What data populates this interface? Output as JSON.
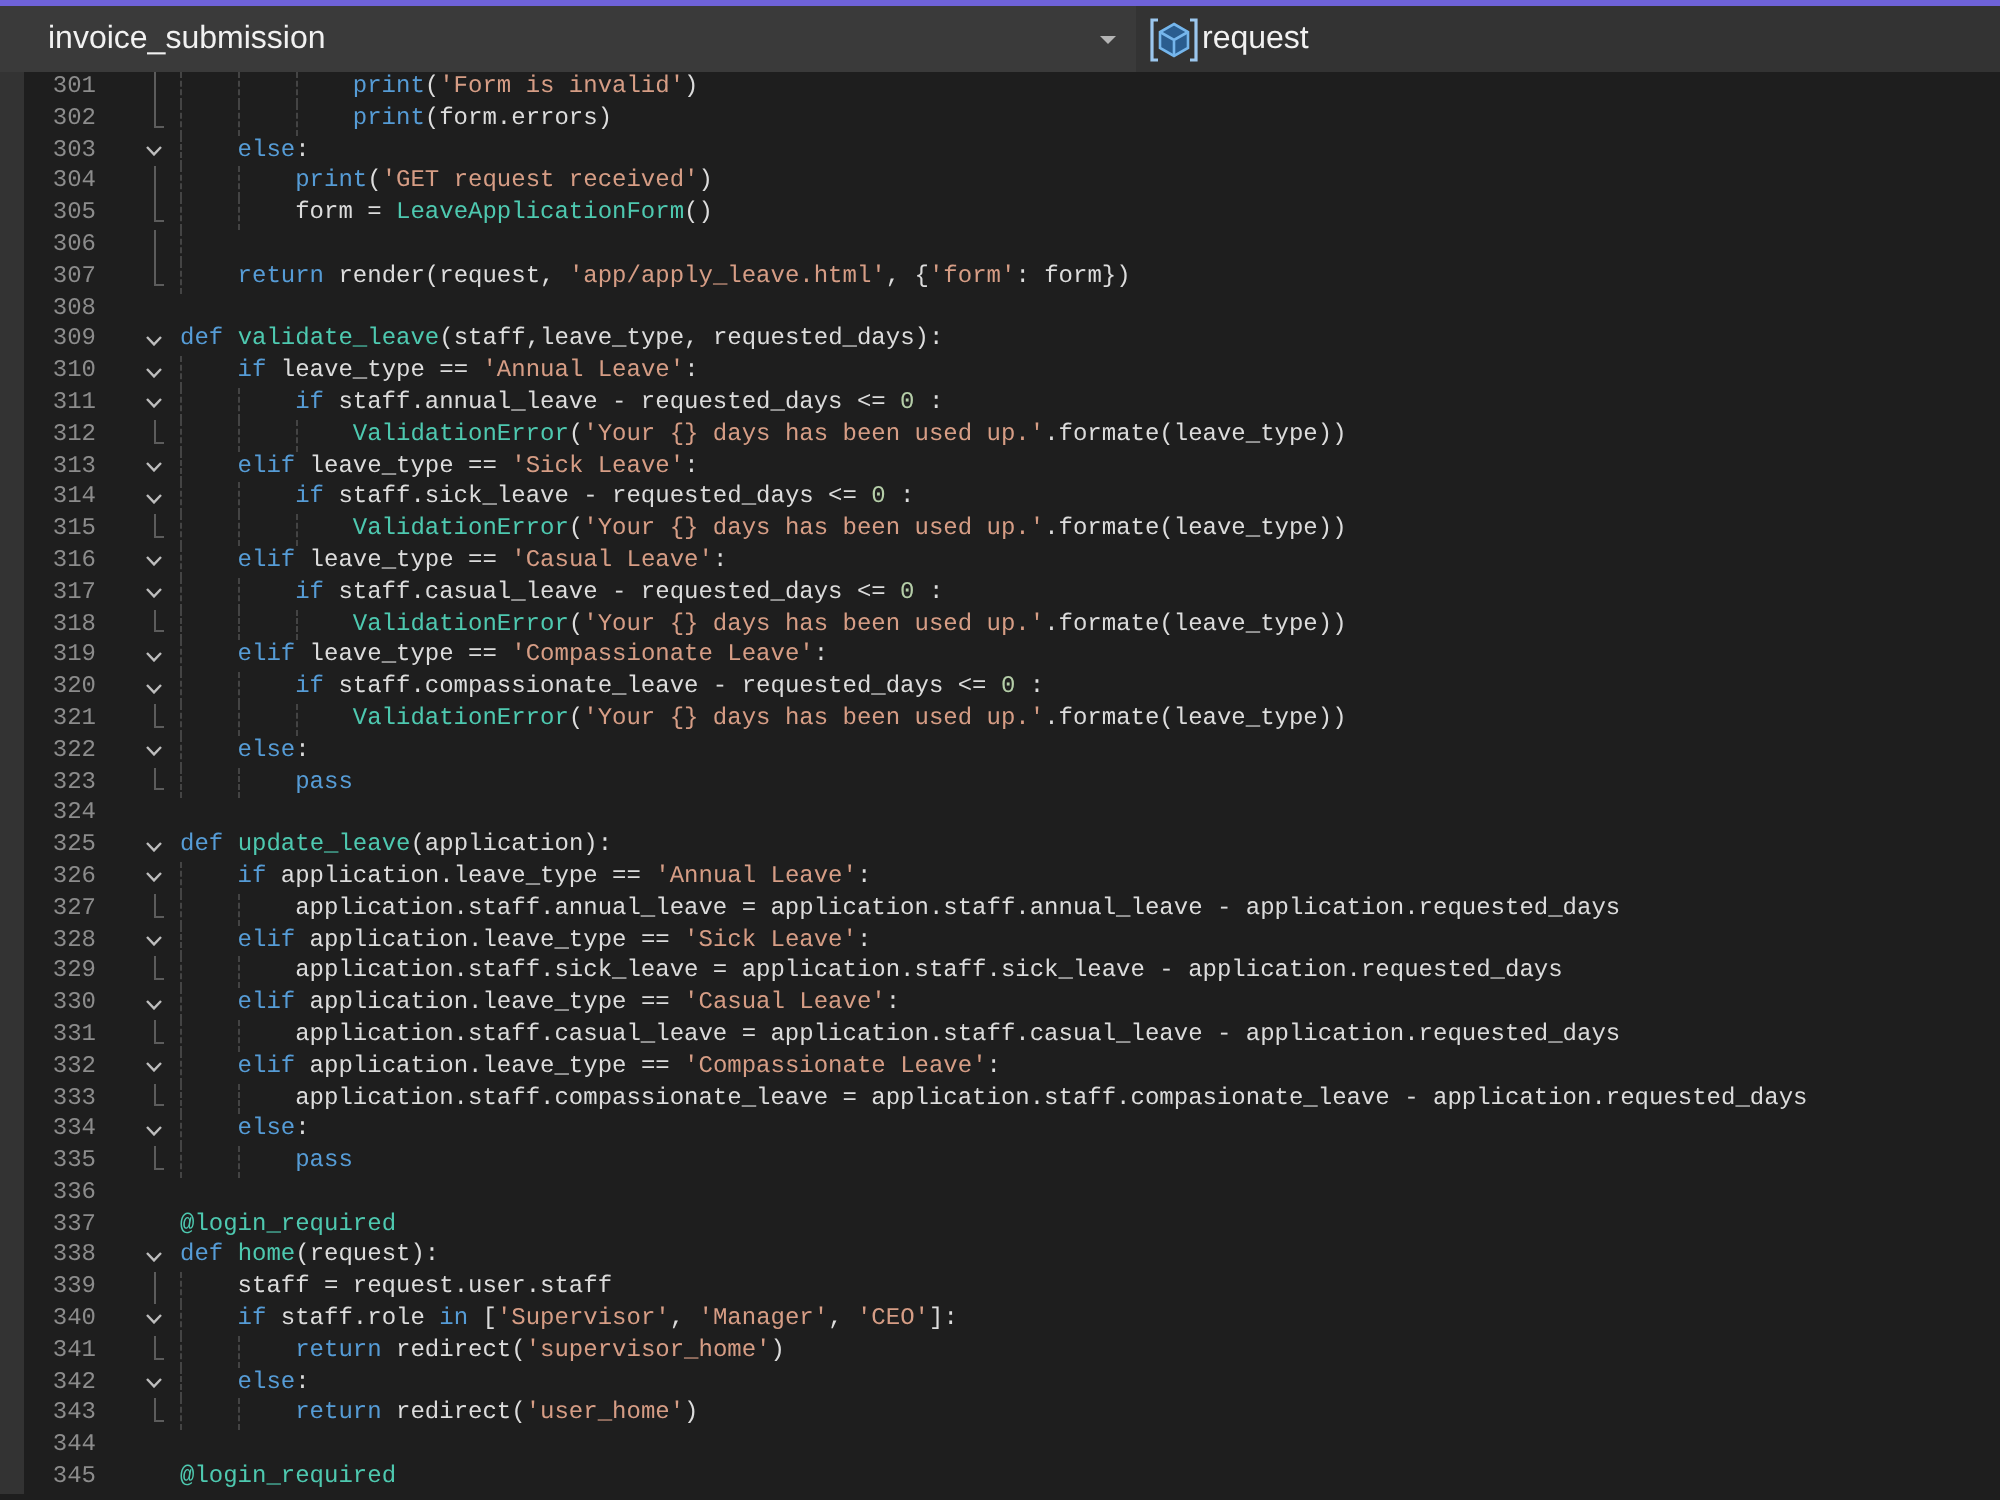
{
  "navigation_bar": {
    "scope": "invoice_submission",
    "member": "request"
  },
  "editor": {
    "lines": [
      {
        "number": "301",
        "code": [
          {
            "kind": "builtin",
            "text": "            print"
          },
          {
            "kind": "plain",
            "text": "("
          },
          {
            "kind": "string",
            "text": "'Form is invalid'"
          },
          {
            "kind": "plain",
            "text": ")"
          }
        ]
      },
      {
        "number": "302",
        "code": [
          {
            "kind": "builtin",
            "text": "            print"
          },
          {
            "kind": "plain",
            "text": "(form.errors)"
          }
        ]
      },
      {
        "number": "303",
        "expanded": true,
        "code": [
          {
            "kind": "keyword",
            "text": "    else"
          },
          {
            "kind": "plain",
            "text": ":"
          }
        ]
      },
      {
        "number": "304",
        "code": [
          {
            "kind": "builtin",
            "text": "        print"
          },
          {
            "kind": "plain",
            "text": "("
          },
          {
            "kind": "string",
            "text": "'GET request received'"
          },
          {
            "kind": "plain",
            "text": ")"
          }
        ]
      },
      {
        "number": "305",
        "code": [
          {
            "kind": "plain",
            "text": "        form = "
          },
          {
            "kind": "function",
            "text": "LeaveApplicationForm"
          },
          {
            "kind": "plain",
            "text": "()"
          }
        ]
      },
      {
        "number": "306"
      },
      {
        "number": "307",
        "code": [
          {
            "kind": "keyword",
            "text": "    return"
          },
          {
            "kind": "plain",
            "text": " render(request, "
          },
          {
            "kind": "string",
            "text": "'app/apply_leave.html'"
          },
          {
            "kind": "plain",
            "text": ", {"
          },
          {
            "kind": "string",
            "text": "'form'"
          },
          {
            "kind": "plain",
            "text": ": form})"
          }
        ]
      },
      {
        "number": "308"
      },
      {
        "number": "309",
        "expanded": true,
        "code": [
          {
            "kind": "keyword",
            "text": "def "
          },
          {
            "kind": "function",
            "text": "validate_leave"
          },
          {
            "kind": "plain",
            "text": "(staff,leave_type, requested_days):"
          }
        ]
      },
      {
        "number": "310",
        "expanded": true,
        "code": [
          {
            "kind": "keyword",
            "text": "    if"
          },
          {
            "kind": "plain",
            "text": " leave_type == "
          },
          {
            "kind": "string",
            "text": "'Annual Leave'"
          },
          {
            "kind": "plain",
            "text": ":"
          }
        ]
      },
      {
        "number": "311",
        "expanded": true,
        "code": [
          {
            "kind": "keyword",
            "text": "        if"
          },
          {
            "kind": "plain",
            "text": " staff.annual_leave - requested_days <= "
          },
          {
            "kind": "number",
            "text": "0"
          },
          {
            "kind": "plain",
            "text": " :"
          }
        ]
      },
      {
        "number": "312",
        "code": [
          {
            "kind": "function",
            "text": "            ValidationError"
          },
          {
            "kind": "plain",
            "text": "("
          },
          {
            "kind": "string",
            "text": "'Your {} days has been used up.'"
          },
          {
            "kind": "plain",
            "text": ".formate(leave_type))"
          }
        ]
      },
      {
        "number": "313",
        "expanded": true,
        "code": [
          {
            "kind": "keyword",
            "text": "    elif"
          },
          {
            "kind": "plain",
            "text": " leave_type == "
          },
          {
            "kind": "string",
            "text": "'Sick Leave'"
          },
          {
            "kind": "plain",
            "text": ":"
          }
        ]
      },
      {
        "number": "314",
        "expanded": true,
        "code": [
          {
            "kind": "keyword",
            "text": "        if"
          },
          {
            "kind": "plain",
            "text": " staff.sick_leave - requested_days <= "
          },
          {
            "kind": "number",
            "text": "0"
          },
          {
            "kind": "plain",
            "text": " :"
          }
        ]
      },
      {
        "number": "315",
        "code": [
          {
            "kind": "function",
            "text": "            ValidationError"
          },
          {
            "kind": "plain",
            "text": "("
          },
          {
            "kind": "string",
            "text": "'Your {} days has been used up.'"
          },
          {
            "kind": "plain",
            "text": ".formate(leave_type))"
          }
        ]
      },
      {
        "number": "316",
        "expanded": true,
        "code": [
          {
            "kind": "keyword",
            "text": "    elif"
          },
          {
            "kind": "plain",
            "text": " leave_type == "
          },
          {
            "kind": "string",
            "text": "'Casual Leave'"
          },
          {
            "kind": "plain",
            "text": ":"
          }
        ]
      },
      {
        "number": "317",
        "expanded": true,
        "code": [
          {
            "kind": "keyword",
            "text": "        if"
          },
          {
            "kind": "plain",
            "text": " staff.casual_leave - requested_days <= "
          },
          {
            "kind": "number",
            "text": "0"
          },
          {
            "kind": "plain",
            "text": " :"
          }
        ]
      },
      {
        "number": "318",
        "code": [
          {
            "kind": "function",
            "text": "            ValidationError"
          },
          {
            "kind": "plain",
            "text": "("
          },
          {
            "kind": "string",
            "text": "'Your {} days has been used up.'"
          },
          {
            "kind": "plain",
            "text": ".formate(leave_type))"
          }
        ]
      },
      {
        "number": "319",
        "expanded": true,
        "code": [
          {
            "kind": "keyword",
            "text": "    elif"
          },
          {
            "kind": "plain",
            "text": " leave_type == "
          },
          {
            "kind": "string",
            "text": "'Compassionate Leave'"
          },
          {
            "kind": "plain",
            "text": ":"
          }
        ]
      },
      {
        "number": "320",
        "expanded": true,
        "code": [
          {
            "kind": "keyword",
            "text": "        if"
          },
          {
            "kind": "plain",
            "text": " staff.compassionate_leave - requested_days <= "
          },
          {
            "kind": "number",
            "text": "0"
          },
          {
            "kind": "plain",
            "text": " :"
          }
        ]
      },
      {
        "number": "321",
        "code": [
          {
            "kind": "function",
            "text": "            ValidationError"
          },
          {
            "kind": "plain",
            "text": "("
          },
          {
            "kind": "string",
            "text": "'Your {} days has been used up.'"
          },
          {
            "kind": "plain",
            "text": ".formate(leave_type))"
          }
        ]
      },
      {
        "number": "322",
        "expanded": true,
        "code": [
          {
            "kind": "keyword",
            "text": "    else"
          },
          {
            "kind": "plain",
            "text": ":"
          }
        ]
      },
      {
        "number": "323",
        "code": [
          {
            "kind": "keyword",
            "text": "        pass"
          }
        ]
      },
      {
        "number": "324"
      },
      {
        "number": "325",
        "expanded": true,
        "code": [
          {
            "kind": "keyword",
            "text": "def "
          },
          {
            "kind": "function",
            "text": "update_leave"
          },
          {
            "kind": "plain",
            "text": "(application):"
          }
        ]
      },
      {
        "number": "326",
        "expanded": true,
        "code": [
          {
            "kind": "keyword",
            "text": "    if"
          },
          {
            "kind": "plain",
            "text": " application.leave_type == "
          },
          {
            "kind": "string",
            "text": "'Annual Leave'"
          },
          {
            "kind": "plain",
            "text": ":"
          }
        ]
      },
      {
        "number": "327",
        "code": [
          {
            "kind": "plain",
            "text": "        application.staff.annual_leave = application.staff.annual_leave - application.requested_days"
          }
        ]
      },
      {
        "number": "328",
        "expanded": true,
        "code": [
          {
            "kind": "keyword",
            "text": "    elif"
          },
          {
            "kind": "plain",
            "text": " application.leave_type == "
          },
          {
            "kind": "string",
            "text": "'Sick Leave'"
          },
          {
            "kind": "plain",
            "text": ":"
          }
        ]
      },
      {
        "number": "329",
        "code": [
          {
            "kind": "plain",
            "text": "        application.staff.sick_leave = application.staff.sick_leave - application.requested_days"
          }
        ]
      },
      {
        "number": "330",
        "expanded": true,
        "code": [
          {
            "kind": "keyword",
            "text": "    elif"
          },
          {
            "kind": "plain",
            "text": " application.leave_type == "
          },
          {
            "kind": "string",
            "text": "'Casual Leave'"
          },
          {
            "kind": "plain",
            "text": ":"
          }
        ]
      },
      {
        "number": "331",
        "code": [
          {
            "kind": "plain",
            "text": "        application.staff.casual_leave = application.staff.casual_leave - application.requested_days"
          }
        ]
      },
      {
        "number": "332",
        "expanded": true,
        "code": [
          {
            "kind": "keyword",
            "text": "    elif"
          },
          {
            "kind": "plain",
            "text": " application.leave_type == "
          },
          {
            "kind": "string",
            "text": "'Compassionate Leave'"
          },
          {
            "kind": "plain",
            "text": ":"
          }
        ]
      },
      {
        "number": "333",
        "code": [
          {
            "kind": "plain",
            "text": "        application.staff.compassionate_leave = application.staff.compasionate_leave - application.requested_days"
          }
        ]
      },
      {
        "number": "334",
        "expanded": true,
        "code": [
          {
            "kind": "keyword",
            "text": "    else"
          },
          {
            "kind": "plain",
            "text": ":"
          }
        ]
      },
      {
        "number": "335",
        "code": [
          {
            "kind": "keyword",
            "text": "        pass"
          }
        ]
      },
      {
        "number": "336"
      },
      {
        "number": "337",
        "code": [
          {
            "kind": "decorator",
            "text": "@login_required"
          }
        ]
      },
      {
        "number": "338",
        "expanded": true,
        "code": [
          {
            "kind": "keyword",
            "text": "def "
          },
          {
            "kind": "function",
            "text": "home"
          },
          {
            "kind": "plain",
            "text": "(request):"
          }
        ]
      },
      {
        "number": "339",
        "code": [
          {
            "kind": "plain",
            "text": "    staff = request.user.staff"
          }
        ]
      },
      {
        "number": "340",
        "expanded": true,
        "code": [
          {
            "kind": "keyword",
            "text": "    if"
          },
          {
            "kind": "plain",
            "text": " staff.role "
          },
          {
            "kind": "keyword",
            "text": "in"
          },
          {
            "kind": "plain",
            "text": " ["
          },
          {
            "kind": "string",
            "text": "'Supervisor'"
          },
          {
            "kind": "plain",
            "text": ", "
          },
          {
            "kind": "string",
            "text": "'Manager'"
          },
          {
            "kind": "plain",
            "text": ", "
          },
          {
            "kind": "string",
            "text": "'CEO'"
          },
          {
            "kind": "plain",
            "text": "]:"
          }
        ]
      },
      {
        "number": "341",
        "code": [
          {
            "kind": "keyword",
            "text": "        return"
          },
          {
            "kind": "plain",
            "text": " redirect("
          },
          {
            "kind": "string",
            "text": "'supervisor_home'"
          },
          {
            "kind": "plain",
            "text": ")"
          }
        ]
      },
      {
        "number": "342",
        "expanded": true,
        "code": [
          {
            "kind": "keyword",
            "text": "    else"
          },
          {
            "kind": "plain",
            "text": ":"
          }
        ]
      },
      {
        "number": "343",
        "code": [
          {
            "kind": "keyword",
            "text": "        return"
          },
          {
            "kind": "plain",
            "text": " redirect("
          },
          {
            "kind": "string",
            "text": "'user_home'"
          },
          {
            "kind": "plain",
            "text": ")"
          }
        ]
      },
      {
        "number": "344"
      },
      {
        "number": "345",
        "code": [
          {
            "kind": "decorator",
            "text": "@login_required"
          }
        ]
      }
    ]
  }
}
